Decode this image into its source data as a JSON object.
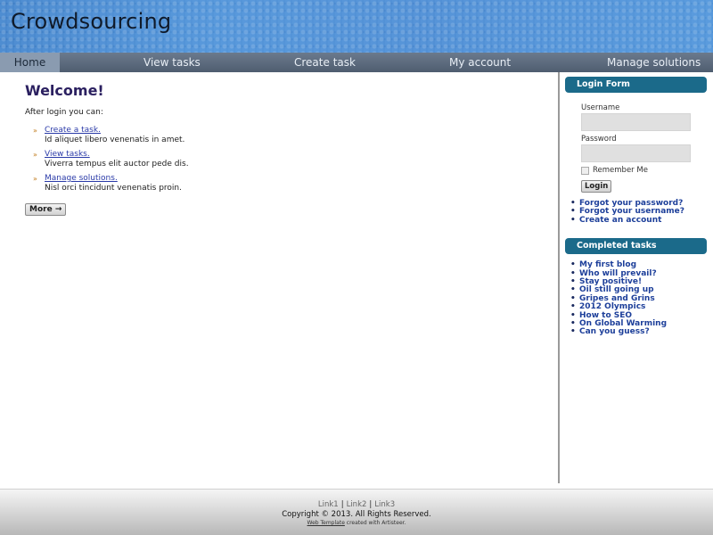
{
  "header": {
    "site_title": "Crowdsourcing"
  },
  "nav": {
    "items": [
      {
        "label": "Home"
      },
      {
        "label": "View tasks"
      },
      {
        "label": "Create task"
      },
      {
        "label": "My account"
      },
      {
        "label": "Manage solutions"
      }
    ]
  },
  "main": {
    "title": "Welcome!",
    "intro": "After login you can:",
    "items": [
      {
        "link": "Create a task.",
        "desc": "Id aliquet libero venenatis in amet."
      },
      {
        "link": "View tasks.",
        "desc": "Viverra tempus elit auctor pede dis."
      },
      {
        "link": "Manage solutions.",
        "desc": "Nisl orci tincidunt venenatis proin."
      }
    ],
    "more_label": "More →"
  },
  "login": {
    "title": "Login Form",
    "username_label": "Username",
    "username_value": "",
    "password_label": "Password",
    "password_value": "",
    "remember_label": "Remember Me",
    "login_button": "Login",
    "links": [
      "Forgot your password?",
      "Forgot your username?",
      "Create an account"
    ]
  },
  "completed": {
    "title": "Completed tasks",
    "items": [
      "My first blog",
      "Who will prevail?",
      "Stay positive!",
      "Oil still going up",
      "Gripes and Grins",
      "2012 Olympics",
      "How to SEO",
      "On Global Warming",
      "Can you guess?"
    ]
  },
  "footer": {
    "links": [
      "Link1",
      "Link2",
      "Link3"
    ],
    "separator": "|",
    "copyright": "Copyright © 2013. All Rights Reserved.",
    "credit_link": "Web Template",
    "credit_text": " created with Artisteer."
  },
  "colors": {
    "header_bg": "#4a86c8",
    "nav_bg": "#5c6b7e",
    "nav_active": "#8a9bb0",
    "sidebar_header": "#1b6a8a",
    "heading": "#2b2060",
    "link": "#2a3aa8",
    "sidebar_link": "#1d3f9a",
    "bullet_accent": "#c07a1b"
  },
  "icons": {
    "list_bullet": "double-chevron-icon",
    "more_arrow": "right-arrow-icon"
  }
}
